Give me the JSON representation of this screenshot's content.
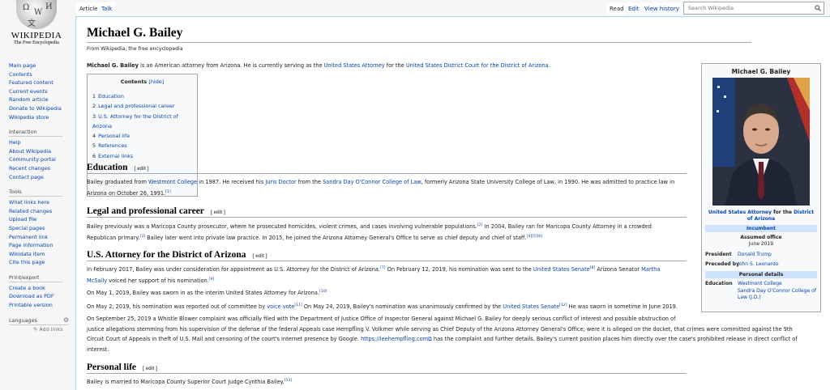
{
  "logo": {
    "wordmark": "Wikipedia",
    "wordmark_display": "WIKIPEDIA",
    "tagline": "The Free Encyclopedia"
  },
  "sidebar": {
    "nav": [
      "Main page",
      "Contents",
      "Featured content",
      "Current events",
      "Random article",
      "Donate to Wikipedia",
      "Wikipedia store"
    ],
    "interaction": {
      "heading": "Interaction",
      "items": [
        "Help",
        "About Wikipedia",
        "Community portal",
        "Recent changes",
        "Contact page"
      ]
    },
    "tools": {
      "heading": "Tools",
      "items": [
        "What links here",
        "Related changes",
        "Upload file",
        "Special pages",
        "Permanent link",
        "Page information",
        "Wikidata item",
        "Cite this page"
      ]
    },
    "print": {
      "heading": "Print/export",
      "items": [
        "Create a book",
        "Download as PDF",
        "Printable version"
      ]
    },
    "languages": {
      "heading": "Languages",
      "add_links": "Add links"
    }
  },
  "tabs": {
    "article": "Article",
    "talk": "Talk",
    "read": "Read",
    "edit": "Edit",
    "history": "View history"
  },
  "search": {
    "placeholder": "Search Wikipedia"
  },
  "page": {
    "title": "Michael G. Bailey",
    "tagline": "From Wikipedia, the free encyclopedia",
    "lead": {
      "bold": "Michael G. Bailey",
      "t1": " is an American attorney from Arizona. He is currently serving as the ",
      "l1": "United States Attorney",
      "t2": " for the ",
      "l2": "United States District Court for the District of Arizona",
      "t3": "."
    },
    "toc": {
      "title": "Contents",
      "hide": "[hide]",
      "items": [
        {
          "n": "1",
          "label": "Education"
        },
        {
          "n": "2",
          "label": "Legal and professional career"
        },
        {
          "n": "3",
          "label": "U.S. Attorney for the District of Arizona"
        },
        {
          "n": "4",
          "label": "Personal life"
        },
        {
          "n": "5",
          "label": "References"
        },
        {
          "n": "6",
          "label": "External links"
        }
      ]
    },
    "edit_label": "[ edit ]",
    "education": {
      "heading": "Education",
      "t1": "Bailey graduated from ",
      "l1": "Westmont College",
      "t2": " in 1987. He received his ",
      "l2": "Juris Doctor",
      "t3": " from the ",
      "l3": "Sandra Day O'Connor College of Law",
      "t4": ", formerly Arizona State University College of Law, in 1990. He was admitted to practice law in",
      "t5": "Arizona on October 26, 1991.",
      "r1": "[1]"
    },
    "legal": {
      "heading": "Legal and professional career",
      "t1": "Bailey previously was a Maricopa County prosecutor, where he prosecuted homicides, violent crimes, and cases involving vulnerable populations.",
      "r1": "[2]",
      "t2": " In 2004, Bailey ran for Maricopa County Attorney in a crowded",
      "t3": "Republican primary.",
      "r2": "[3]",
      "t4": " Bailey later went into private law practice. In 2015, he joined the Arizona Attorney General's Office to serve as chief deputy and chief of staff.",
      "r3": "[4][5][6]"
    },
    "usattorney": {
      "heading": "U.S. Attorney for the District of Arizona",
      "p1": {
        "t1": "In February 2017, Bailey was under consideration for appointment as U.S. Attorney for the District of Arizona.",
        "r1": "[7]",
        "t2": " On February 12, 2019, his nomination was sent to the ",
        "l1": "United States Senate",
        "r2": "[8]",
        "t3": " Arizona Senator ",
        "l2": "Martha",
        "l3": "McSally",
        "t4": " voiced her support of his nomination.",
        "r3": "[9]"
      },
      "p2": {
        "t1": "On May 1, 2019, Bailey was sworn in as the interim United States Attorney for Arizona.",
        "r1": "[10]"
      },
      "p3": {
        "t1": "On May 2, 2019, his nomination was reported out of committee by ",
        "l1": "voice vote",
        "r1": "[11]",
        "t2": " On May 24, 2019, Bailey's nomination was unanimously confirmed by the ",
        "l2": "United States Senate",
        "r2": "[12]",
        "t3": " He was sworn in sometime in June 2019."
      },
      "p4": {
        "line1": "On September 25, 2019 a Whistle Blower complaint was officially filed with the Department of Justice Office of Inspector General against Michael G. Bailey for deeply serious conflict of interest and possible obstruction of",
        "line2": "justice allegations stemming from his supervision of the defense of the federal Appeals case Hempfling V. Volkmer while serving as Chief Deputy of the Arizona Attorney General's Office; were it is alleged on the docket, that crimes were committed against the 9th",
        "line3a": "Circuit Court of Appeals in theft of U.S. Mail and censoring of the court's internet presence by Google. ",
        "link": "https://leehempfling.com",
        "line3b": " has the complaint and further details. Bailey's current position places him directly over the case's prohibited release in direct conflict of",
        "line4": "interest."
      }
    },
    "personal": {
      "heading": "Personal life",
      "t1": "Bailey is married to Maricopa County Superior Court Judge Cynthia Bailey.",
      "r1": "[13]"
    }
  },
  "infobox": {
    "name": "Michael G. Bailey",
    "caption_l1": "United States Attorney",
    "caption_t": " for the ",
    "caption_l2": "District of Arizona",
    "incumbent": "Incumbent",
    "assumed": "Assumed office",
    "assumed_date": "June 2019",
    "president_k": "President",
    "president_v": "Donald Trump",
    "preceded_k": "Preceded by",
    "preceded_v": "John S. Leonardo",
    "personal_details": "Personal details",
    "education_k": "Education",
    "education_v1": "Westmont College",
    "education_v2": "Sandra Day O'Connor College of Law (J.D.)"
  },
  "colors": {
    "link": "#0645ad",
    "infobox_band": "#cfe3ff",
    "content_border": "#a7d7f9"
  }
}
